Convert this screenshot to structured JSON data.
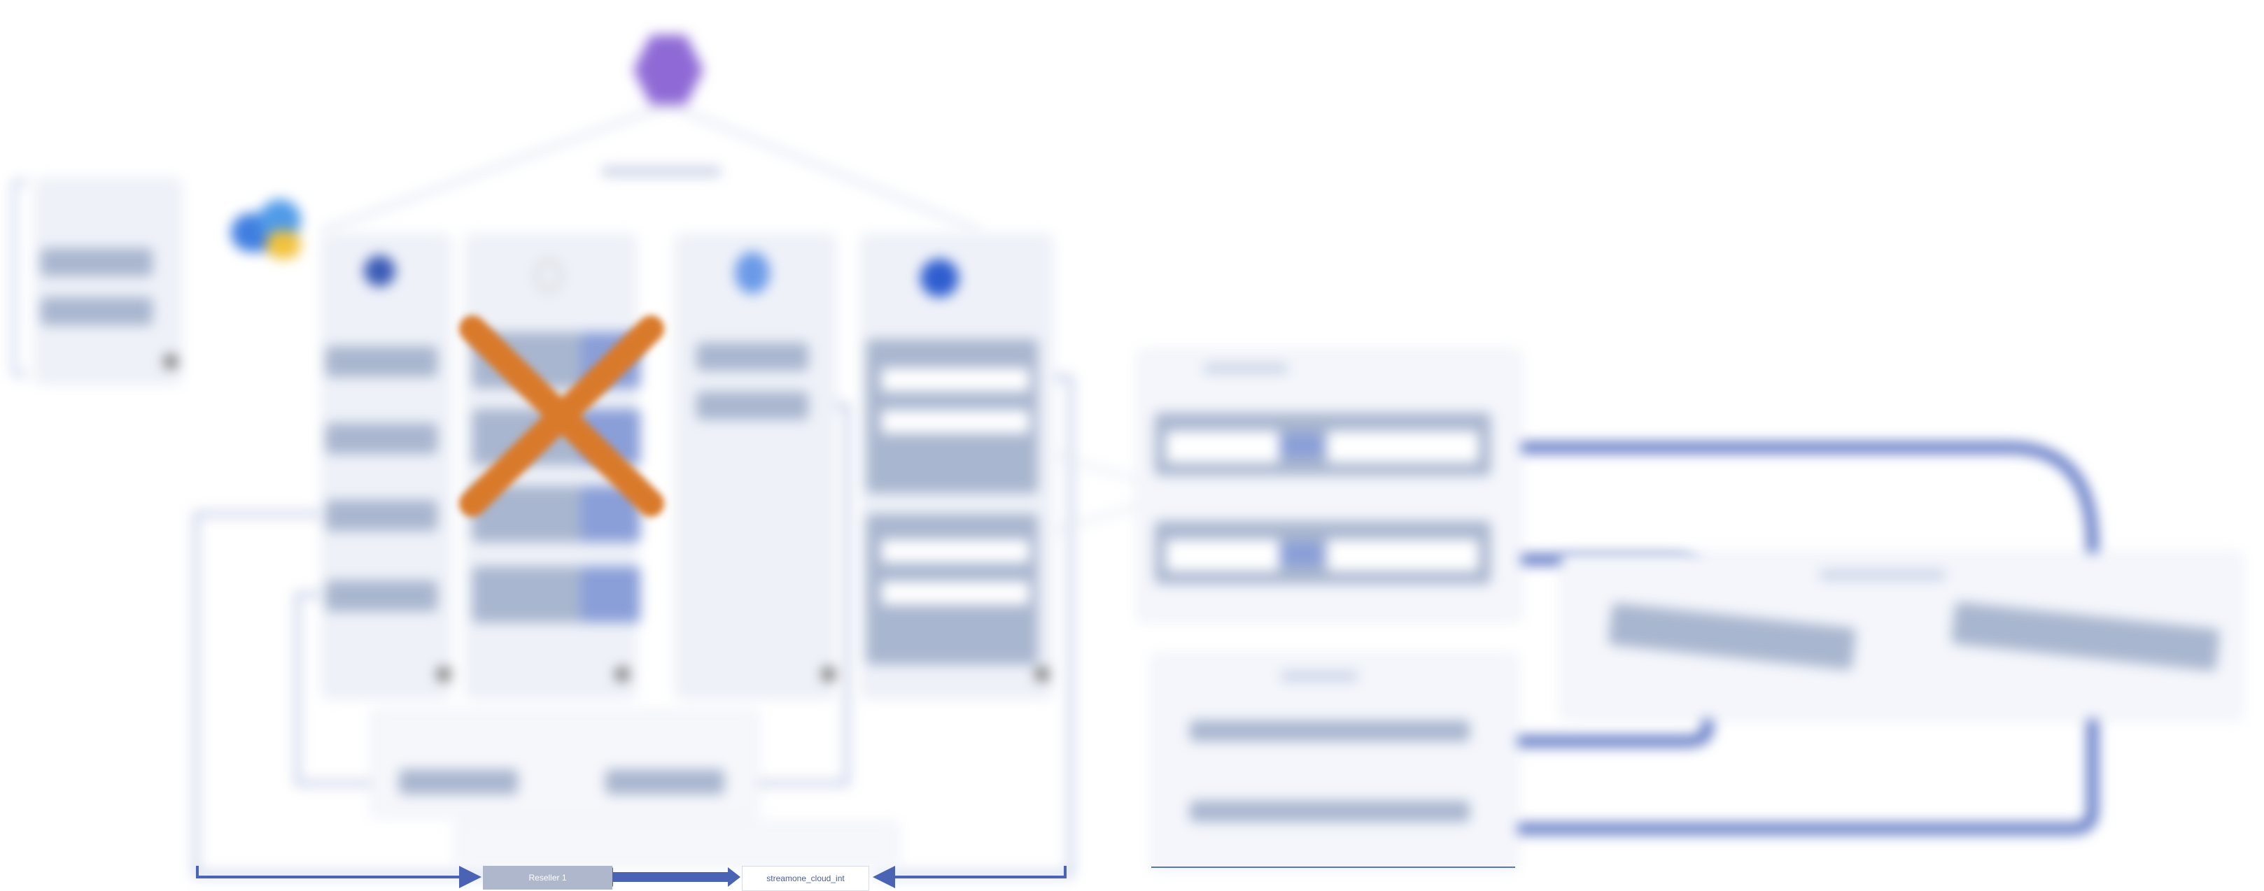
{
  "colors": {
    "background": "#ffffff",
    "pane": "#eef1f8",
    "bar": "#a9b6cf",
    "accent_blue": "#5b74c2",
    "cross_orange": "#d97a2b",
    "hexagon_purple": "#8f6ad6"
  },
  "icons": {
    "top": "purple-hexagon-icon",
    "cloud": "multi-cloud-icon",
    "cross": "x-mark-icon"
  },
  "labels": {
    "reseller": "Reseller 1",
    "cloud_int": "streamone_cloud_int"
  }
}
